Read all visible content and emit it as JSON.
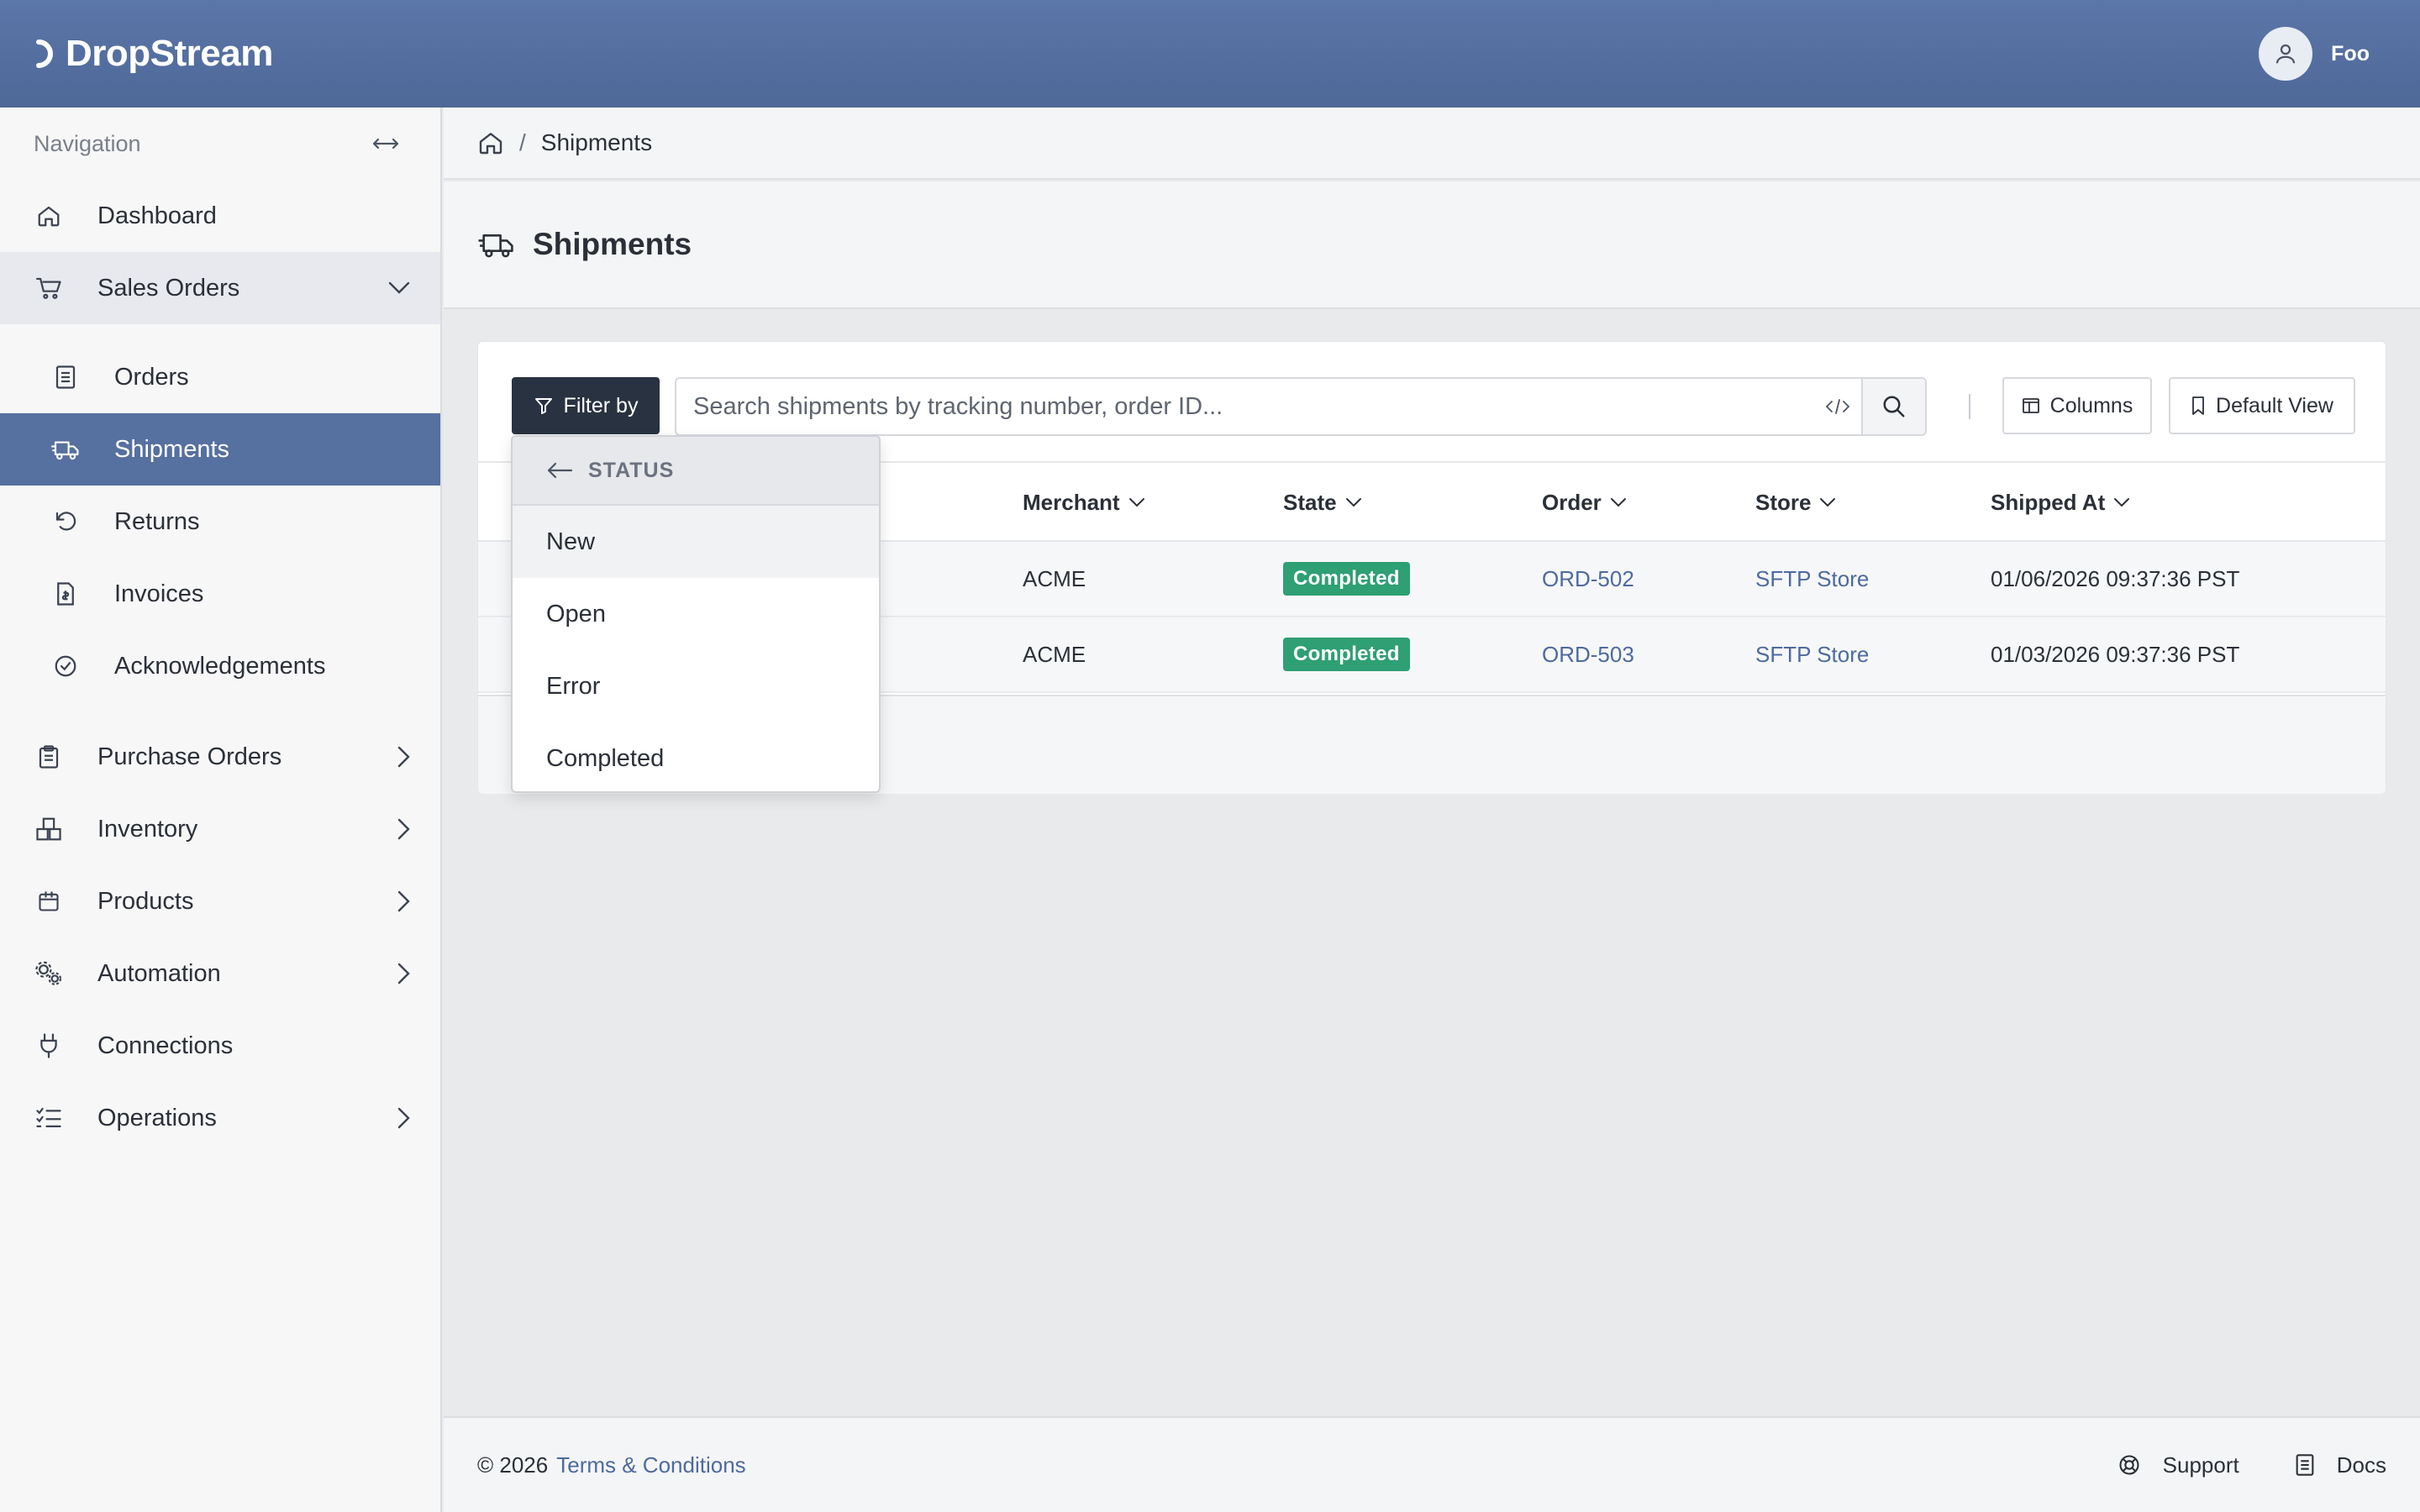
{
  "header": {
    "brand": "DropStream",
    "user_name": "Foo"
  },
  "sidebar": {
    "title": "Navigation",
    "items": [
      {
        "label": "Dashboard",
        "icon": "home-icon"
      },
      {
        "label": "Sales Orders",
        "icon": "cart-icon",
        "expanded": true
      },
      {
        "label": "Purchase Orders",
        "icon": "clipboard-icon"
      },
      {
        "label": "Inventory",
        "icon": "boxes-icon"
      },
      {
        "label": "Products",
        "icon": "package-icon"
      },
      {
        "label": "Automation",
        "icon": "gears-icon"
      },
      {
        "label": "Connections",
        "icon": "plug-icon"
      },
      {
        "label": "Operations",
        "icon": "list-check-icon"
      }
    ],
    "sales_sub": [
      {
        "label": "Orders",
        "icon": "document-icon"
      },
      {
        "label": "Shipments",
        "icon": "truck-icon",
        "active": true
      },
      {
        "label": "Returns",
        "icon": "undo-icon"
      },
      {
        "label": "Invoices",
        "icon": "invoice-icon"
      },
      {
        "label": "Acknowledgements",
        "icon": "check-circle-icon"
      }
    ]
  },
  "breadcrumb": {
    "current": "Shipments"
  },
  "page": {
    "title": "Shipments"
  },
  "toolbar": {
    "filter_label": "Filter by",
    "search_placeholder": "Search shipments by tracking number, order ID...",
    "columns_label": "Columns",
    "view_label": "Default View"
  },
  "table": {
    "columns": [
      "Merchant",
      "State",
      "Order",
      "Store",
      "Shipped At"
    ],
    "rows": [
      {
        "merchant": "ACME",
        "state": "Completed",
        "order": "ORD-502",
        "store": "SFTP Store",
        "shipped_at": "01/06/2026 09:37:36 PST"
      },
      {
        "merchant": "ACME",
        "state": "Completed",
        "order": "ORD-503",
        "store": "SFTP Store",
        "shipped_at": "01/03/2026 09:37:36 PST"
      }
    ]
  },
  "filter_dropdown": {
    "header": "STATUS",
    "options": [
      "New",
      "Open",
      "Error",
      "Completed"
    ]
  },
  "footer": {
    "copyright": "© 2026",
    "terms": "Terms & Conditions",
    "support": "Support",
    "docs": "Docs"
  },
  "colors": {
    "header": "#5b76a8",
    "active_nav": "#56709f",
    "badge_completed": "#2f9f74",
    "link": "#4d6a9f"
  }
}
